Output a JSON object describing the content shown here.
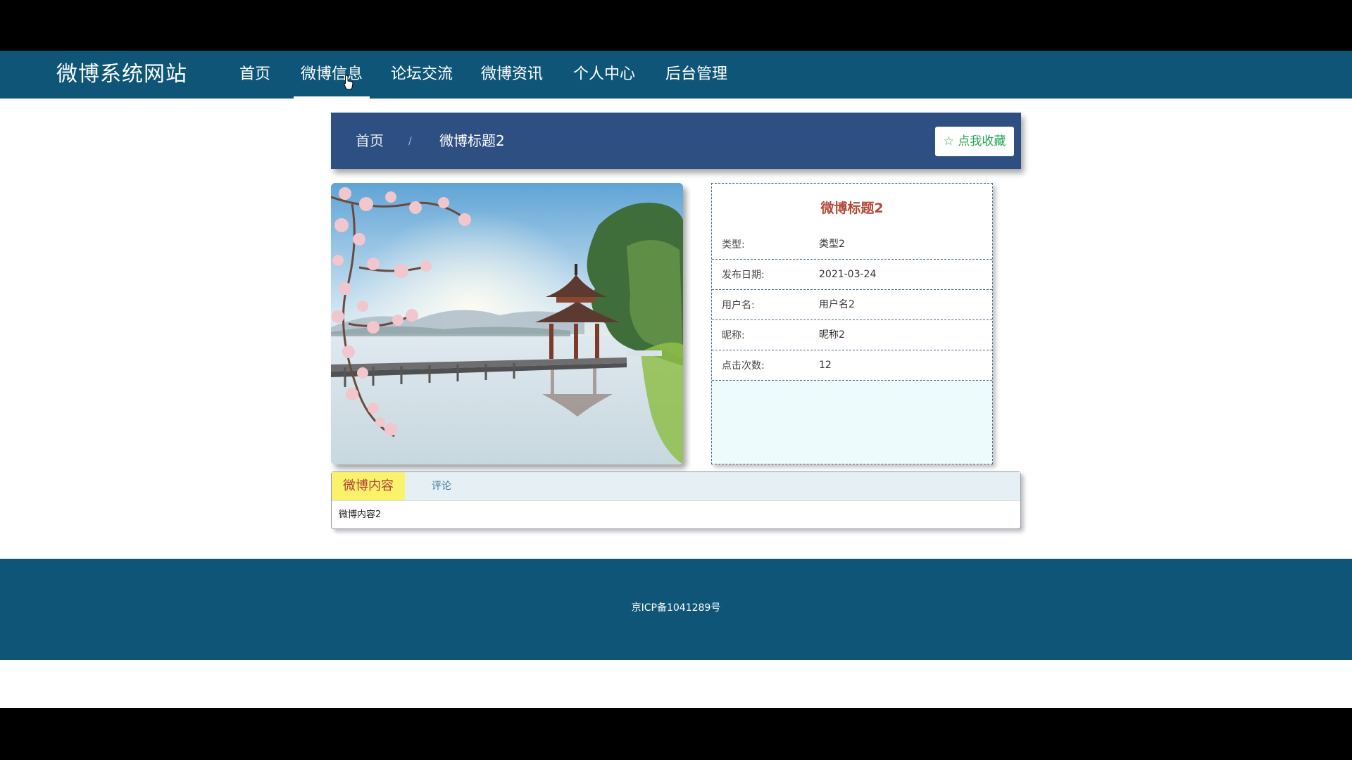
{
  "site": {
    "title": "微博系统网站"
  },
  "nav": {
    "items": [
      {
        "label": "首页"
      },
      {
        "label": "微博信息",
        "active": true
      },
      {
        "label": "论坛交流"
      },
      {
        "label": "微博资讯"
      },
      {
        "label": "个人中心"
      },
      {
        "label": "后台管理"
      }
    ]
  },
  "breadcrumb": {
    "home": "首页",
    "separator": "/",
    "current": "微博标题2",
    "favorite_button": "☆ 点我收藏"
  },
  "detail": {
    "title": "微博标题2",
    "fields": [
      {
        "label": "类型:",
        "value": "类型2"
      },
      {
        "label": "发布日期:",
        "value": "2021-03-24"
      },
      {
        "label": "用户名:",
        "value": "用户名2"
      },
      {
        "label": "昵称:",
        "value": "昵称2"
      },
      {
        "label": "点击次数:",
        "value": "12"
      }
    ]
  },
  "tabs": {
    "items": [
      {
        "label": "微博内容",
        "active": true
      },
      {
        "label": "评论"
      }
    ],
    "content": "微博内容2"
  },
  "footer": {
    "icp": "京ICP备1041289号"
  },
  "colors": {
    "nav_bg": "#0e5577",
    "crumb_bg": "#2e4f82",
    "title_accent": "#b24a3b",
    "favorite_green": "#27a555",
    "tab_active_bg": "#fbf26b"
  }
}
